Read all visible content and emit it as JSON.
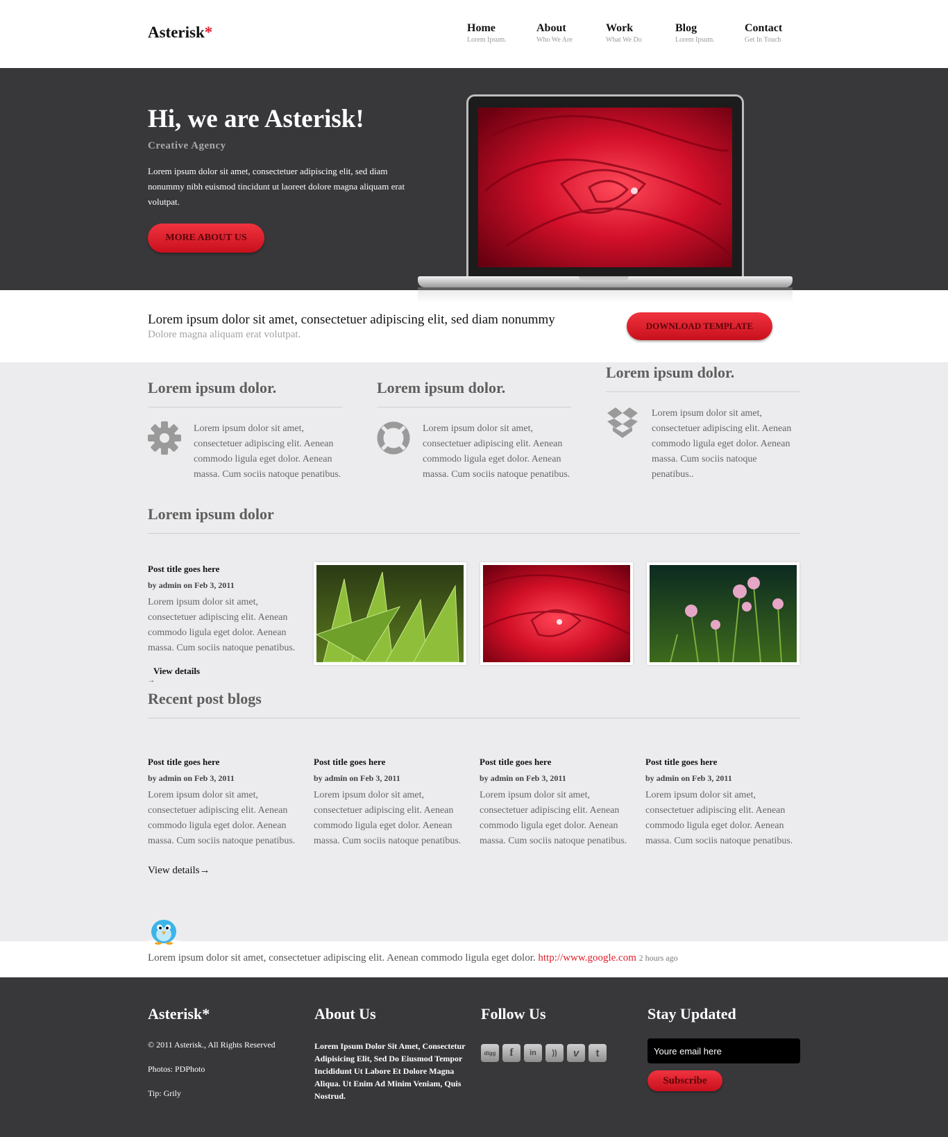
{
  "header": {
    "logo": "Asterisk",
    "logo_star": "*",
    "nav": [
      {
        "title": "Home",
        "sub": "Lorem Ipsum."
      },
      {
        "title": "About",
        "sub": "Who We Are"
      },
      {
        "title": "Work",
        "sub": "What We Do"
      },
      {
        "title": "Blog",
        "sub": "Lorem Ipsum."
      },
      {
        "title": "Contact",
        "sub": "Get In Touch"
      }
    ]
  },
  "hero": {
    "title": "Hi, we are Asterisk!",
    "subtitle": "Creative Agency",
    "text": "Lorem ipsum dolor sit amet, consectetuer adipiscing elit, sed diam nonummy nibh euismod tincidunt ut laoreet dolore magna aliquam erat volutpat.",
    "button": "MORE ABOUT US"
  },
  "banner": {
    "title": "Lorem ipsum dolor sit amet, consectetuer adipiscing elit, sed diam nonummy",
    "subtitle": "Dolore magna aliquam erat volutpat.",
    "button": "DOWNLOAD TEMPLATE"
  },
  "features": [
    {
      "title": "Lorem ipsum dolor.",
      "icon": "gear-icon",
      "text": "Lorem ipsum dolor sit amet, consectetuer adipiscing elit. Aenean commodo ligula eget dolor. Aenean massa. Cum sociis natoque penatibus."
    },
    {
      "title": "Lorem ipsum dolor.",
      "icon": "lifebuoy-icon",
      "text": "Lorem ipsum dolor sit amet, consectetuer adipiscing elit. Aenean commodo ligula eget dolor. Aenean massa. Cum sociis natoque penatibus."
    },
    {
      "title": "Lorem ipsum dolor.",
      "icon": "box-icon",
      "text": "Lorem ipsum dolor sit amet, consectetuer adipiscing elit. Aenean commodo ligula eget dolor. Aenean massa. Cum sociis natoque penatibus.."
    }
  ],
  "portfolio": {
    "title": "Lorem ipsum dolor",
    "post_title": "Post title goes here",
    "meta": "by admin on Feb 3, 2011",
    "text": "Lorem ipsum dolor sit amet, consectetuer adipiscing elit. Aenean commodo ligula eget dolor. Aenean massa. Cum sociis natoque penatibus.",
    "link": "View details",
    "arrow": "→"
  },
  "recent": {
    "title": "Recent post blogs",
    "posts": [
      {
        "title": "Post title goes here",
        "meta": "by admin on Feb 3, 2011",
        "text": "Lorem ipsum dolor sit amet, consectetuer adipiscing elit. Aenean commodo ligula eget dolor. Aenean massa. Cum sociis natoque penatibus."
      },
      {
        "title": "Post title goes here",
        "meta": "by admin on Feb 3, 2011",
        "text": "Lorem ipsum dolor sit amet, consectetuer adipiscing elit. Aenean commodo ligula eget dolor. Aenean massa. Cum sociis natoque penatibus."
      },
      {
        "title": "Post title goes here",
        "meta": "by admin on Feb 3, 2011",
        "text": "Lorem ipsum dolor sit amet, consectetuer adipiscing elit. Aenean commodo ligula eget dolor. Aenean massa. Cum sociis natoque penatibus."
      },
      {
        "title": "Post title goes here",
        "meta": "by admin on Feb 3, 2011",
        "text": "Lorem ipsum dolor sit amet, consectetuer adipiscing elit. Aenean commodo ligula eget dolor. Aenean massa. Cum sociis natoque penatibus."
      }
    ],
    "link": "View details→"
  },
  "tweet": {
    "text": "Lorem ipsum dolor sit amet, consectetuer adipiscing elit. Aenean commodo ligula eget dolor.",
    "link": "http://www.google.com",
    "time": "2 hours ago"
  },
  "footer": {
    "brand": "Asterisk*",
    "copyright": "© 2011 Asterisk., All Rights Reserved",
    "photos": "Photos: PDPhoto",
    "tip": "Tip: Grily",
    "about_title": "About Us",
    "about_text": "Lorem Ipsum Dolor Sit Amet, Consectetur Adipisicing Elit, Sed Do Eiusmod Tempor Incididunt Ut Labore Et Dolore Magna Aliqua. Ut Enim Ad Minim Veniam, Quis Nostrud.",
    "follow_title": "Follow Us",
    "socials": [
      {
        "icon": "digg-icon",
        "glyph": "digg"
      },
      {
        "icon": "facebook-icon",
        "glyph": "f"
      },
      {
        "icon": "linkedin-icon",
        "glyph": "in"
      },
      {
        "icon": "rss-icon",
        "glyph": "))"
      },
      {
        "icon": "vimeo-icon",
        "glyph": "v"
      },
      {
        "icon": "twitter-icon",
        "glyph": "t"
      }
    ],
    "stay_title": "Stay Updated",
    "email_placeholder": "Youre email here",
    "subscribe": "Subscribe"
  },
  "colors": {
    "accent": "#e01e2b",
    "hero_bg": "#38383b",
    "content_bg": "#ececee"
  }
}
